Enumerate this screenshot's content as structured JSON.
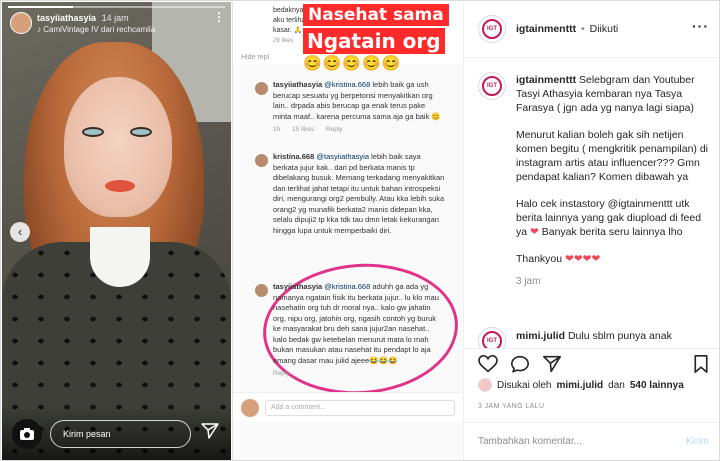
{
  "story": {
    "username": "tasyiiathasyia",
    "time": "14 jam",
    "subtitle": "CamiVintage IV dari rechcamila",
    "message_placeholder": "Kirim pesan",
    "progress": 0.3
  },
  "collage": {
    "top_text_1": "bedaknya da",
    "top_text_2": "aku terlihat",
    "top_text_3": "kasar. 🙏",
    "top_likes": "29 likes",
    "hide_label": "Hide repl",
    "banner_line1": "Nasehat sama",
    "banner_line2": "Ngatain org",
    "emojis": "😊😊😊😊😊",
    "comments": [
      {
        "user": "tasyiiathasyia",
        "mention": "@kristina.668",
        "text": "lebih baik ga ush berucap sesuatu yg berpetonsi menyakitkan org lain.. drpada abis berucap ga enak terus pake minta maaf.. karena percuma sama aja ga baik 😊",
        "time": "1h",
        "likes": "15 likes",
        "reply": "Reply"
      },
      {
        "user": "kristina.668",
        "mention": "@tasyiiathasyia",
        "text": "lebih baik saya berkata jujur kak.. dari pd berkata manis tp dibelakang busuk. Memang terkadang menyakitkan dan terlihat jahat tetapi itu untuk bahan introspeksi diri, mengurangi org2 pembully. Atau kka lebih suka orang2 yg munafik berkata2 manis didepan kka, selalu dipuji2 tp kka tdk tau dmn letak kekurangan hingga lupa untuk memperbaiki diri."
      },
      {
        "user": "tasyiiathasyia",
        "mention": "@kristina.668",
        "text": "aduhh ga ada yg namanya ngatain fisik itu berkata jujur.. lu klo mau nasehatin org tuh dr moral nya.. kalo gw jahatin org, nipu org, jatohin org, ngasih contoh yg buruk ke masyarakat bru deh sana jujur2an nasehat.. kalo bedak gw ketebelan menurut mata lo mah bukan masukan atau nasehat itu pendapt lo aja emang dasar mau julid ajeee😂😂😂",
        "reply": "Reply"
      }
    ],
    "add_comment": "Add a comment..."
  },
  "post": {
    "username": "igtainmenttt",
    "separator": "•",
    "follow_status": "Diikuti",
    "caption_user": "igtainmenttt",
    "caption_p1": "Selebgram dan Youtuber Tasyi Athasyia kembaran nya Tasya Farasya ( jgn ada yg nanya lagi siapa)",
    "caption_p2": "Menurut kalian boleh gak sih netijen komen begitu ( mengkritik penampilan) di instagram artis atau influencer??? Gmn pendapat kalian? Komen dibawah ya",
    "caption_p3a": "Halo cek instastory",
    "caption_p3_mention": "@igtainmenttt",
    "caption_p3b": "utk berita lainnya yang gak diupload di feed ya",
    "caption_p3_heart": "❤",
    "caption_p3c": "Banyak berita seru lainnya lho",
    "caption_p4": "Thankyou",
    "caption_p4_hearts": "❤❤❤❤",
    "caption_time": "3 jam",
    "reply_user": "mimi.julid",
    "reply_text": "Dulu sblm punya anak",
    "liked_prefix": "Disukai oleh",
    "liked_user": "mimi.julid",
    "liked_and": "dan",
    "liked_count": "540 lainnya",
    "post_time": "3 JAM YANG LALU",
    "add_comment_placeholder": "Tambahkan komentar...",
    "post_button": "Kirim",
    "logo_text": "IGT"
  }
}
